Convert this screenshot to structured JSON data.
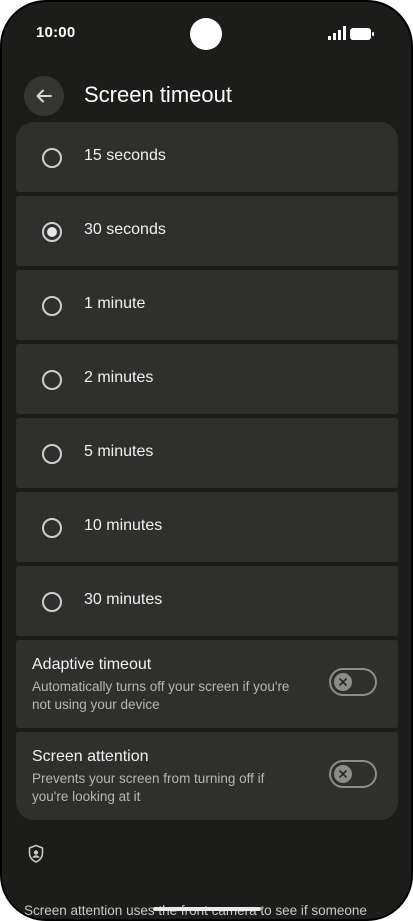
{
  "status_bar": {
    "time": "10:00"
  },
  "app_bar": {
    "title": "Screen timeout",
    "back_icon": "arrow-back-icon"
  },
  "timeout_options": [
    {
      "label": "15 seconds",
      "selected": false
    },
    {
      "label": "30 seconds",
      "selected": true
    },
    {
      "label": "1 minute",
      "selected": false
    },
    {
      "label": "2 minutes",
      "selected": false
    },
    {
      "label": "5 minutes",
      "selected": false
    },
    {
      "label": "10 minutes",
      "selected": false
    },
    {
      "label": "30 minutes",
      "selected": false
    }
  ],
  "adaptive_timeout": {
    "title": "Adaptive timeout",
    "summary": "Automatically turns off your screen if you're not using your device",
    "enabled": false
  },
  "screen_attention": {
    "title": "Screen attention",
    "summary": "Prevents your screen from turning off if you're looking at it",
    "enabled": false
  },
  "footer": {
    "icon": "privacy-shield-icon",
    "text": "Screen attention uses the front camera to see if someone is looking at the screen. It works on-device,"
  },
  "colors": {
    "background": "#1c1c1b",
    "surface": "#2f2f2d",
    "text_primary": "#f1f1f1",
    "text_secondary": "#b6b6b2"
  }
}
